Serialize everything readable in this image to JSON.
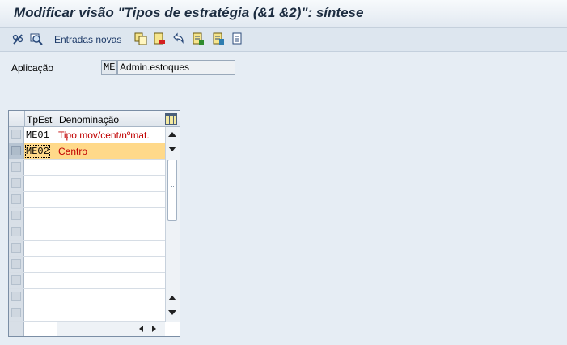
{
  "window": {
    "title": "Modificar visão \"Tipos de estratégia (&1 &2)\": síntese"
  },
  "toolbar": {
    "icons": [
      "edit-glasses-icon",
      "other-object-icon",
      "copy-icon",
      "delete-icon",
      "undo-icon",
      "select-all-icon",
      "select-block-icon",
      "deselect-all-icon"
    ],
    "new_entries_label": "Entradas novas"
  },
  "field": {
    "label": "Aplicação",
    "code": "ME",
    "description": "Admin.estoques"
  },
  "table": {
    "headers": [
      "TpEst",
      "Denominação"
    ],
    "rows": [
      {
        "code": "ME01",
        "name": "Tipo mov/cent/nºmat."
      },
      {
        "code": "ME02",
        "name": "Centro"
      }
    ],
    "selected_row": 1
  },
  "colors": {
    "selected_row": "#ffd98a",
    "description_text": "#c00000",
    "background": "#e6edf4"
  }
}
